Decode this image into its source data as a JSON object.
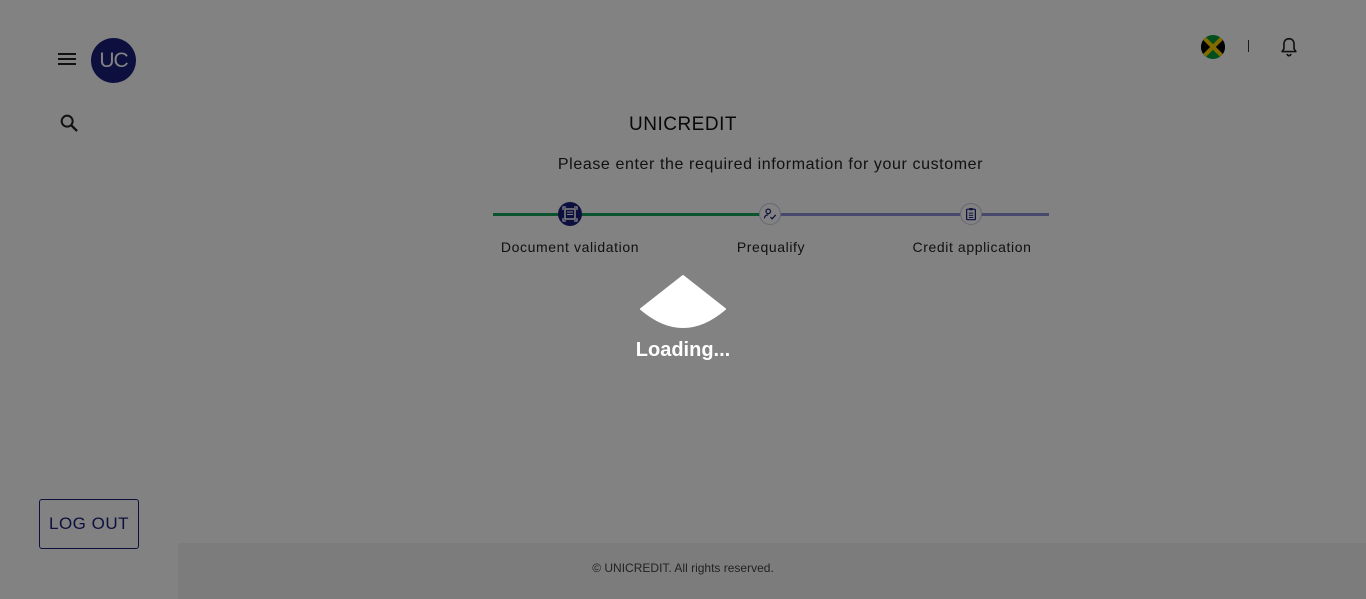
{
  "sidebar": {
    "logo_text": "UC",
    "logout_label": "LOG OUT"
  },
  "header": {
    "flag_icon": "jamaica-flag-icon",
    "notification_icon": "bell-icon"
  },
  "main": {
    "title": "UNICREDIT",
    "subtitle": "Please enter the required information for your customer"
  },
  "stepper": {
    "steps": [
      {
        "label": "Document validation",
        "icon": "document-scan-icon",
        "state": "active"
      },
      {
        "label": "Prequalify",
        "icon": "user-check-icon",
        "state": "pending"
      },
      {
        "label": "Credit application",
        "icon": "clipboard-icon",
        "state": "pending"
      }
    ]
  },
  "loading": {
    "text": "Loading..."
  },
  "footer": {
    "copyright": "© UNICREDIT. All rights reserved."
  },
  "colors": {
    "brand": "#1a1f7a",
    "progress_done": "#16a35a",
    "progress_todo": "#8f8fd6",
    "overlay": "rgba(0,0,0,0.49)"
  }
}
